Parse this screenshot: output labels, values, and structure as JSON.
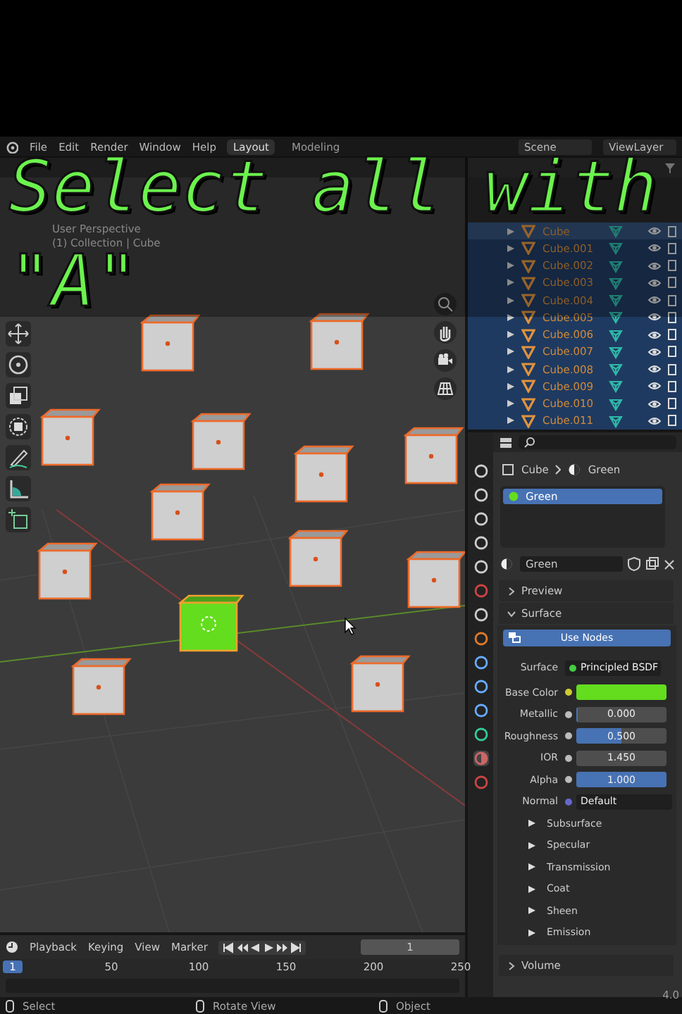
{
  "menu": [
    "File",
    "Edit",
    "Render",
    "Window",
    "Help"
  ],
  "workspaces": [
    {
      "label": "Layout",
      "selected": true
    },
    {
      "label": "Modeling",
      "selected": false
    }
  ],
  "scene": "Scene",
  "view_layer": "ViewLayer",
  "viewport": {
    "view_name": "User Perspective",
    "collection_info": "(1) Collection | Cube"
  },
  "caption": {
    "lines": [
      "Select all with",
      "\"A\""
    ]
  },
  "outliner": {
    "rows": [
      {
        "name": "Cube",
        "selected": true,
        "active": true
      },
      {
        "name": "Cube.001",
        "selected": true,
        "active": false
      },
      {
        "name": "Cube.002",
        "selected": true,
        "active": false
      },
      {
        "name": "Cube.003",
        "selected": true,
        "active": false
      },
      {
        "name": "Cube.004",
        "selected": true,
        "active": false
      },
      {
        "name": "Cube.005",
        "selected": true,
        "active": false
      },
      {
        "name": "Cube.006",
        "selected": true,
        "active": false
      },
      {
        "name": "Cube.007",
        "selected": true,
        "active": false
      },
      {
        "name": "Cube.008",
        "selected": true,
        "active": false
      },
      {
        "name": "Cube.009",
        "selected": true,
        "active": false
      },
      {
        "name": "Cube.010",
        "selected": true,
        "active": false
      },
      {
        "name": "Cube.011",
        "selected": true,
        "active": false
      }
    ]
  },
  "properties": {
    "breadcrumb": [
      "Cube",
      "Green"
    ],
    "slots": [
      {
        "name": "Green",
        "selected": true
      }
    ],
    "material": "Green",
    "panels": [
      {
        "label": "Preview",
        "expanded": false
      },
      {
        "label": "Surface",
        "expanded": true
      },
      {
        "label": "Volume",
        "expanded": false
      }
    ],
    "use_nodes": "Use Nodes",
    "surface": {
      "label": "Surface",
      "value": "Principled BSDF"
    },
    "inputs": [
      {
        "kind": "color",
        "label": "Base Color",
        "color": "#63dd1e"
      },
      {
        "kind": "slider",
        "label": "Metallic",
        "value": "0.000",
        "level": 0
      },
      {
        "kind": "slider",
        "label": "Roughness",
        "value": "0.500",
        "level": 0.5
      },
      {
        "kind": "number",
        "label": "IOR",
        "value": "1.450"
      },
      {
        "kind": "slider",
        "label": "Alpha",
        "value": "1.000",
        "level": 1
      },
      {
        "kind": "link",
        "label": "Normal",
        "value": "Default"
      }
    ],
    "subpanels": [
      {
        "label": "Subsurface",
        "expanded": false
      },
      {
        "label": "Specular",
        "expanded": false
      },
      {
        "label": "Transmission",
        "expanded": false
      },
      {
        "label": "Coat",
        "expanded": false
      },
      {
        "label": "Sheen",
        "expanded": false
      },
      {
        "label": "Emission",
        "expanded": false
      }
    ]
  },
  "version": "4.0",
  "timeline": {
    "menus": [
      "Playback",
      "Keying",
      "View",
      "Marker"
    ],
    "current_frame": "1",
    "ruler_current": "1",
    "ticks": [
      "50",
      "100",
      "150",
      "200",
      "250"
    ]
  },
  "status_bar": [
    "Select",
    "Rotate View",
    "Object"
  ]
}
